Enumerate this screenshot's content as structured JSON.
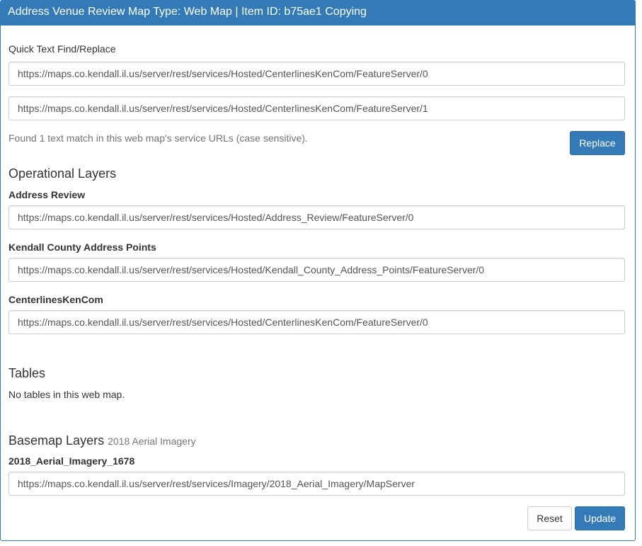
{
  "header": {
    "title": "Address Venue Review Map Type: Web Map | Item ID: b75ae1 Copying"
  },
  "find_replace": {
    "label": "Quick Text Find/Replace",
    "find_value": "https://maps.co.kendall.il.us/server/rest/services/Hosted/CenterlinesKenCom/FeatureServer/0",
    "replace_value": "https://maps.co.kendall.il.us/server/rest/services/Hosted/CenterlinesKenCom/FeatureServer/1",
    "status": "Found 1 text match in this web map's service URLs (case sensitive).",
    "replace_button": "Replace"
  },
  "operational_layers": {
    "title": "Operational Layers",
    "layers": [
      {
        "name": "Address Review",
        "url": "https://maps.co.kendall.il.us/server/rest/services/Hosted/Address_Review/FeatureServer/0"
      },
      {
        "name": "Kendall County Address Points",
        "url": "https://maps.co.kendall.il.us/server/rest/services/Hosted/Kendall_County_Address_Points/FeatureServer/0"
      },
      {
        "name": "CenterlinesKenCom",
        "url": "https://maps.co.kendall.il.us/server/rest/services/Hosted/CenterlinesKenCom/FeatureServer/0"
      }
    ]
  },
  "tables": {
    "title": "Tables",
    "empty_text": "No tables in this web map."
  },
  "basemap": {
    "title": "Basemap Layers",
    "subtitle": "2018 Aerial Imagery",
    "layers": [
      {
        "name": "2018_Aerial_Imagery_1678",
        "url": "https://maps.co.kendall.il.us/server/rest/services/Imagery/2018_Aerial_Imagery/MapServer"
      }
    ]
  },
  "footer": {
    "reset_button": "Reset",
    "update_button": "Update"
  },
  "colors": {
    "primary": "#337ab7",
    "border": "#cccccc",
    "muted_text": "#737373"
  }
}
